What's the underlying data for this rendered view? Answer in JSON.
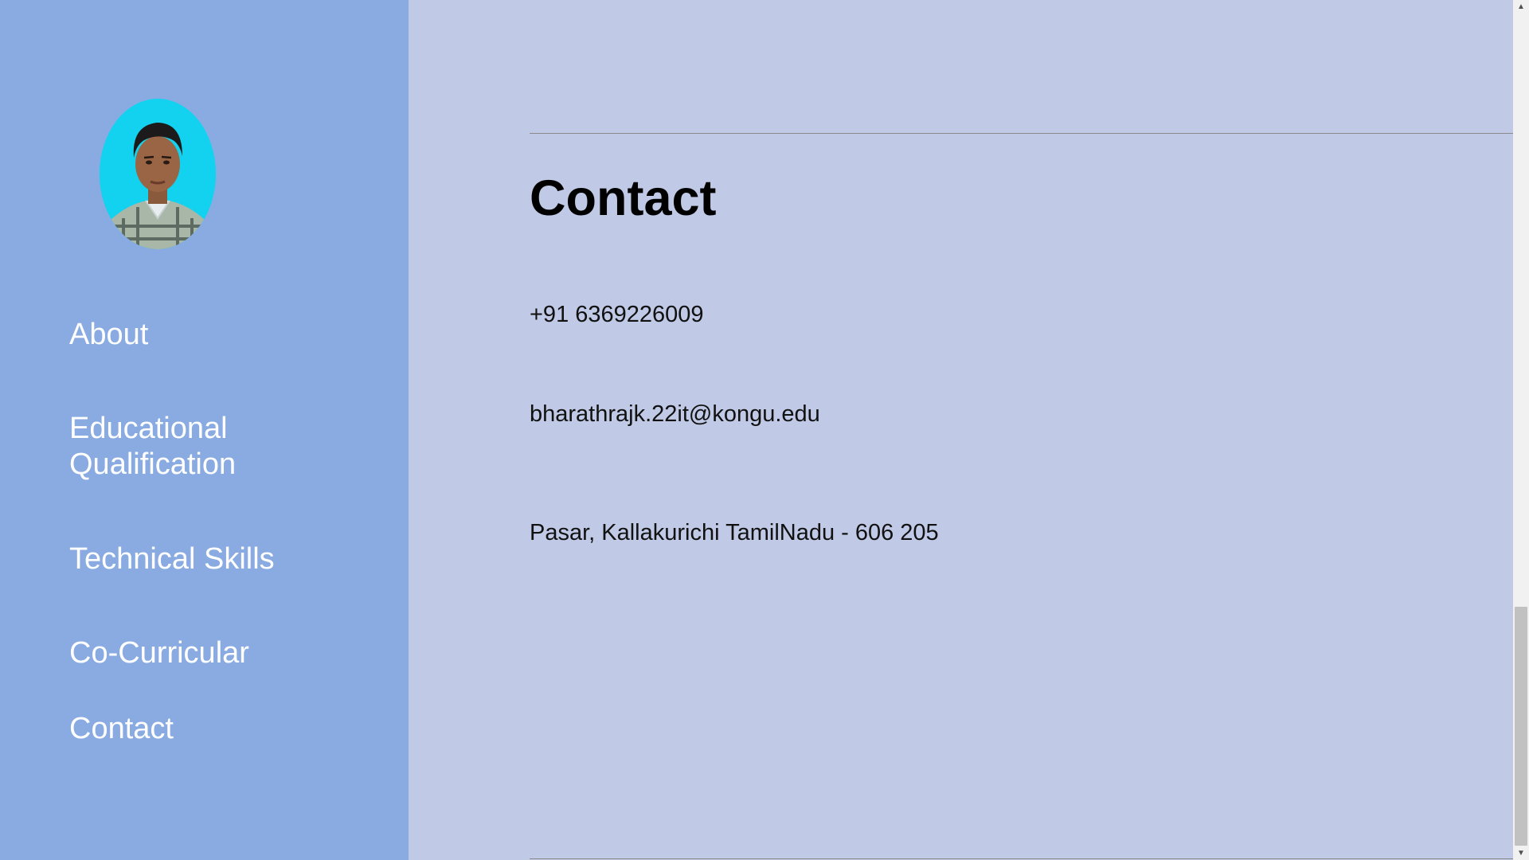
{
  "sidebar": {
    "avatar": {
      "icon": "profile-photo-icon",
      "background_color": "#12d2ef"
    },
    "nav": [
      {
        "label": "About"
      },
      {
        "label": "Educational\nQualification"
      },
      {
        "label": "Technical Skills"
      },
      {
        "label": "Co-Curricular"
      },
      {
        "label": "Contact"
      }
    ]
  },
  "main": {
    "section_title": "Contact",
    "phone": "+91 6369226009",
    "email": "bharathrajk.22it@kongu.edu",
    "address": "Pasar, Kallakurichi TamilNadu - 606 205"
  },
  "scrollbar": {
    "up_icon": "scroll-up-arrow-icon",
    "down_icon": "scroll-down-arrow-icon"
  },
  "colors": {
    "sidebar_bg": "#89abe1",
    "main_bg": "#c0c9e5",
    "nav_text": "#ffffff"
  }
}
